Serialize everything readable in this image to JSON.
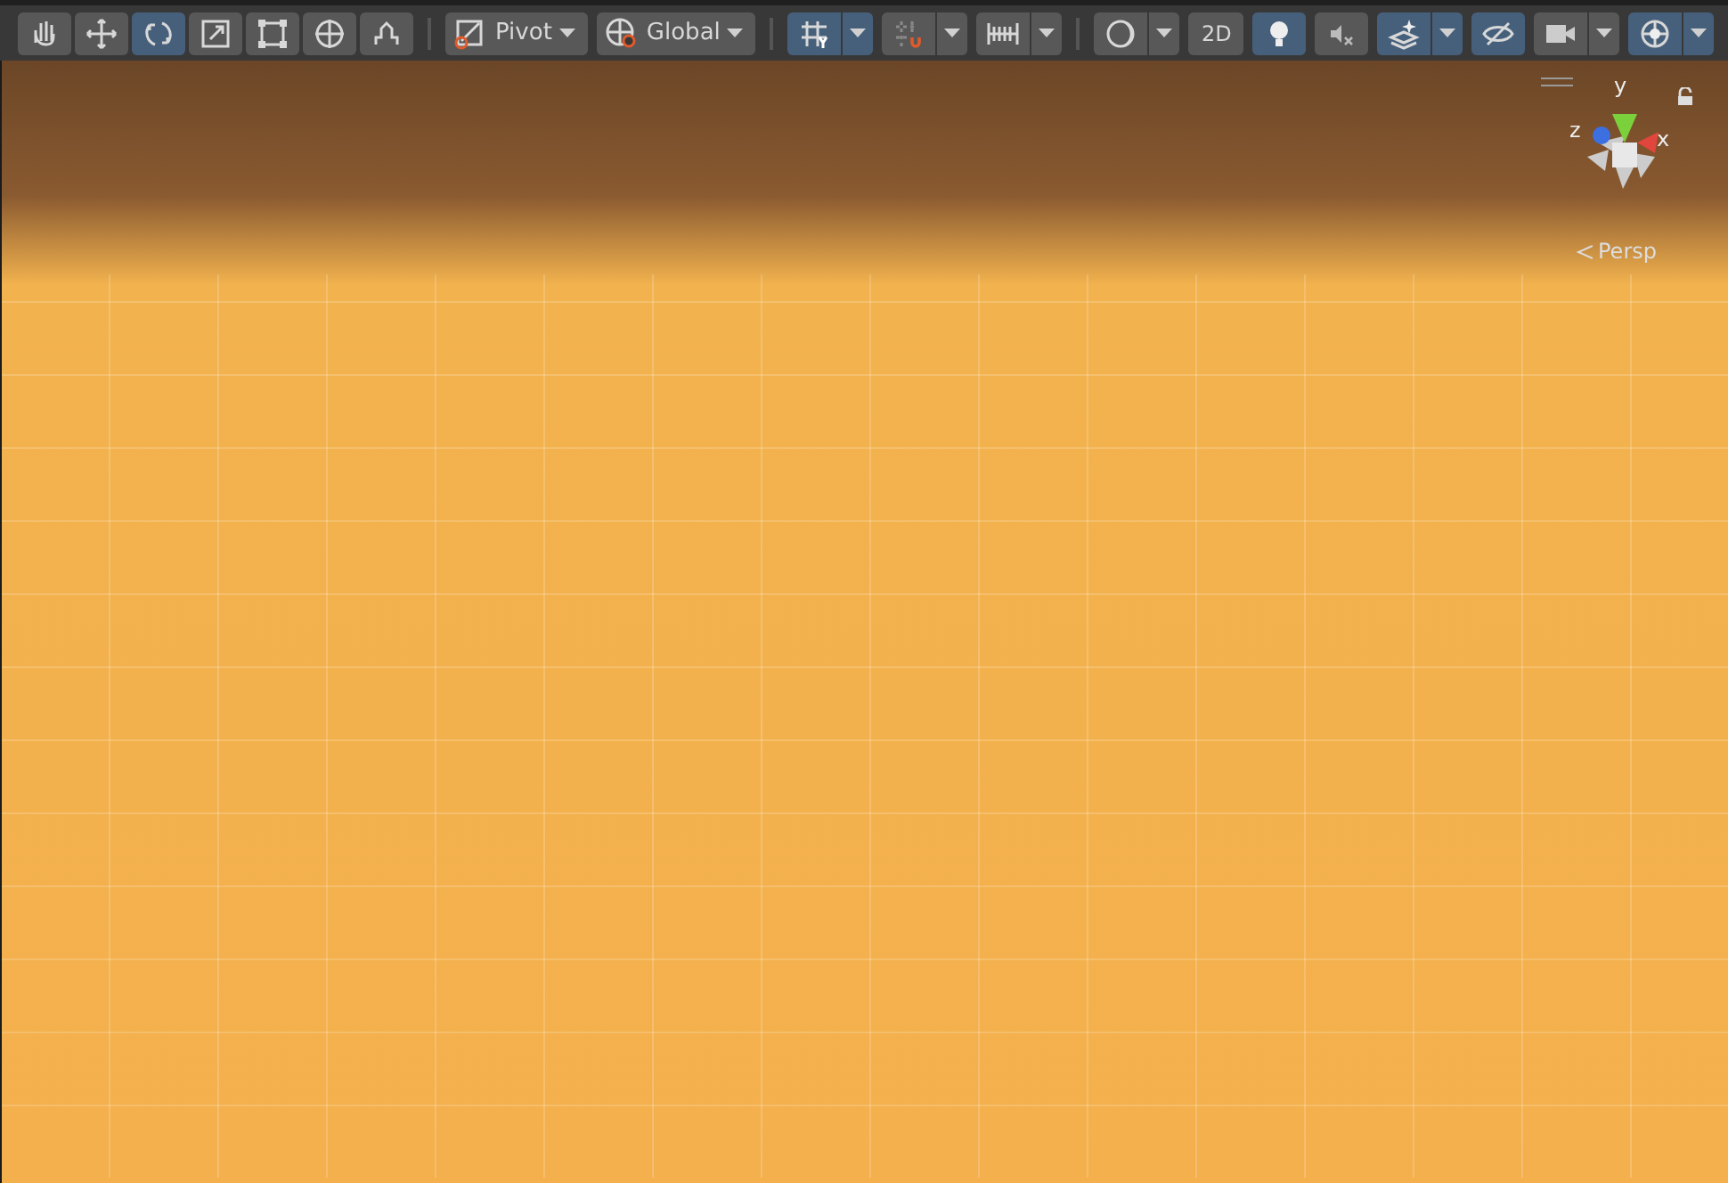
{
  "toolbar": {
    "tools": [
      {
        "kind": "hand",
        "selected": false
      },
      {
        "kind": "move",
        "selected": false
      },
      {
        "kind": "rotate",
        "selected": true
      },
      {
        "kind": "scale",
        "selected": false
      },
      {
        "kind": "rect",
        "selected": false
      },
      {
        "kind": "transform",
        "selected": false
      },
      {
        "kind": "custom",
        "selected": false
      }
    ],
    "handle_dropdowns": [
      {
        "kind": "pivot",
        "label": "Pivot"
      },
      {
        "kind": "global",
        "label": "Global"
      }
    ],
    "snapping": [
      {
        "kind": "grid",
        "on": true,
        "dropdown": true
      },
      {
        "kind": "increment",
        "on": false,
        "dropdown": true
      },
      {
        "kind": "ruler",
        "on": false,
        "dropdown": true
      }
    ],
    "view_options": [
      {
        "kind": "drawmode",
        "on": false,
        "dropdown": true
      },
      {
        "kind": "text",
        "label": "2D",
        "on": false,
        "dropdown": false
      },
      {
        "kind": "light",
        "on": true,
        "dropdown": false
      },
      {
        "kind": "audio",
        "on": false,
        "dropdown": false
      },
      {
        "kind": "effects",
        "on": true,
        "dropdown": true
      },
      {
        "kind": "visibility",
        "on": true,
        "dropdown": false
      },
      {
        "kind": "camera",
        "on": false,
        "dropdown": true
      },
      {
        "kind": "gizmos",
        "on": true,
        "dropdown": true
      }
    ]
  },
  "viewport": {
    "orientation_gizmo": {
      "axes": [
        {
          "kind": "y",
          "label": "y"
        },
        {
          "kind": "z",
          "label": "z"
        },
        {
          "kind": "x",
          "label": "x"
        }
      ],
      "projection": "Persp"
    }
  }
}
